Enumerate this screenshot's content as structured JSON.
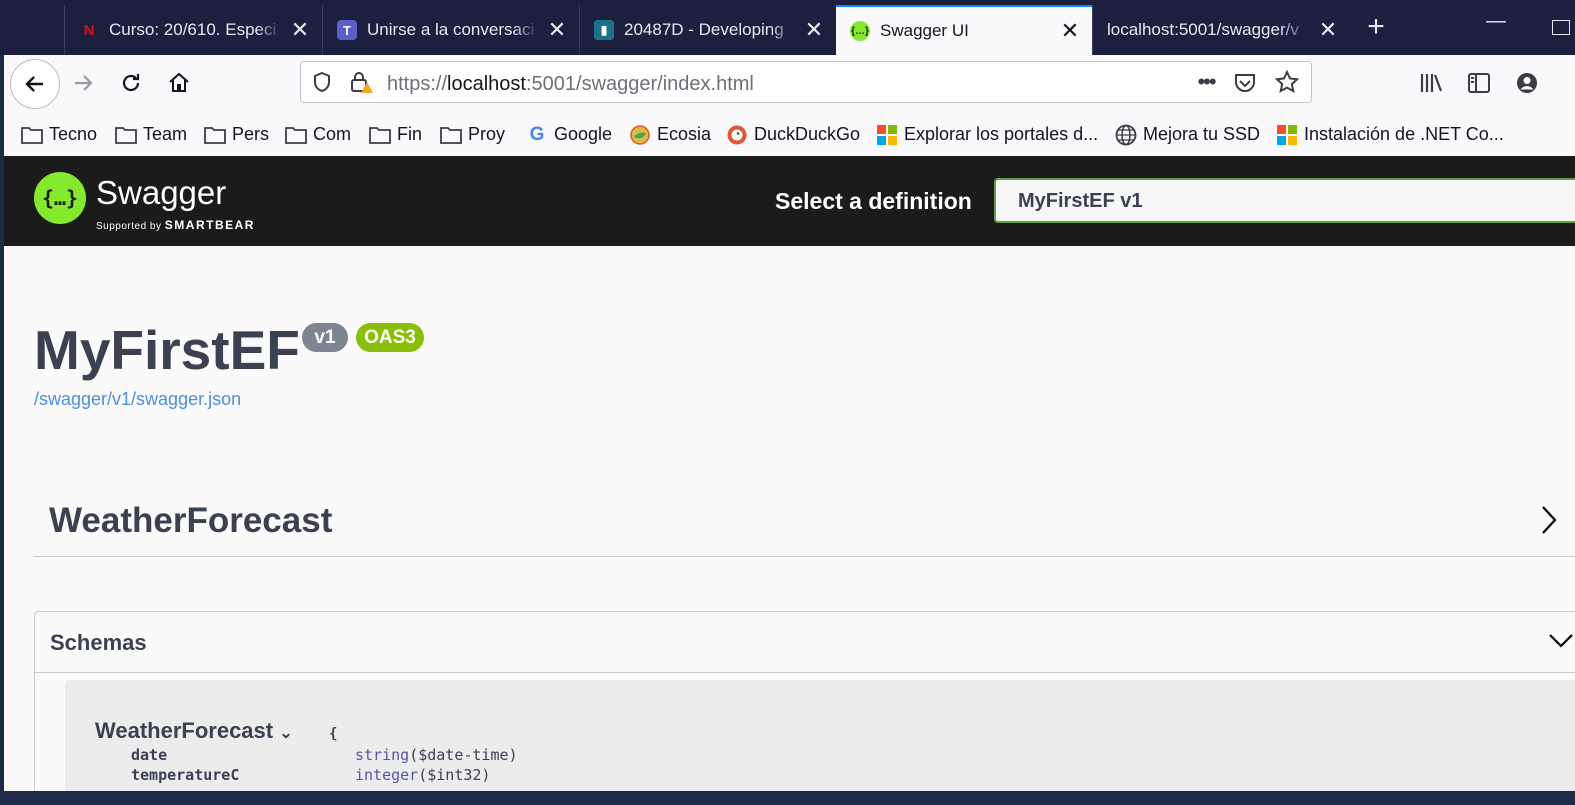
{
  "tabs": [
    {
      "title": "Curso: 20/610. Especi",
      "icon": "netflix-icon",
      "close": "✕"
    },
    {
      "title": "Unirse a la conversaci",
      "icon": "teams-icon",
      "close": "✕"
    },
    {
      "title": "20487D - Developing",
      "icon": "ebook-icon",
      "close": "✕"
    },
    {
      "title": "Swagger UI",
      "icon": "swagger-icon",
      "close": "✕",
      "active": true
    },
    {
      "title": "localhost:5001/swagger/v",
      "icon": "",
      "close": "✕"
    }
  ],
  "new_tab": "+",
  "address": {
    "scheme": "https://",
    "host": "localhost",
    "rest": ":5001/swagger/index.html"
  },
  "bookmarks": [
    {
      "label": "Tecno",
      "icon": "folder-icon"
    },
    {
      "label": "Team",
      "icon": "folder-icon"
    },
    {
      "label": "Pers",
      "icon": "folder-icon"
    },
    {
      "label": "Com",
      "icon": "folder-icon"
    },
    {
      "label": "Fin",
      "icon": "folder-icon"
    },
    {
      "label": "Proy",
      "icon": "folder-icon"
    },
    {
      "label": "Google",
      "icon": "google-icon"
    },
    {
      "label": "Ecosia",
      "icon": "ecosia-icon"
    },
    {
      "label": "DuckDuckGo",
      "icon": "duckduckgo-icon"
    },
    {
      "label": "Explorar los portales d...",
      "icon": "microsoft-icon"
    },
    {
      "label": "Mejora tu SSD",
      "icon": "globe-icon"
    },
    {
      "label": "Instalación de .NET Co...",
      "icon": "microsoft-icon"
    }
  ],
  "swagger": {
    "logo_word": "Swagger",
    "logo_glyph": "{…}",
    "logo_sub": "Supported by",
    "logo_brand": "SMARTBEAR",
    "select_label": "Select a definition",
    "select_value": "MyFirstEF v1"
  },
  "info": {
    "title": "MyFirstEF",
    "version": "v1",
    "oas": "OAS3",
    "link": "/swagger/v1/swagger.json"
  },
  "tag": {
    "name": "WeatherForecast"
  },
  "schemas": {
    "title": "Schemas",
    "model": {
      "name": "WeatherForecast",
      "brace": "{",
      "props": [
        {
          "name": "date",
          "type": "string",
          "format": "($date-time)"
        },
        {
          "name": "temperatureC",
          "type": "integer",
          "format": "($int32)"
        }
      ]
    }
  },
  "colors": {
    "swagger_green": "#85ea2d",
    "oas_badge": "#89bf04",
    "version_badge": "#7d8492",
    "link_blue": "#4990e2",
    "title_text": "#3b4151"
  }
}
